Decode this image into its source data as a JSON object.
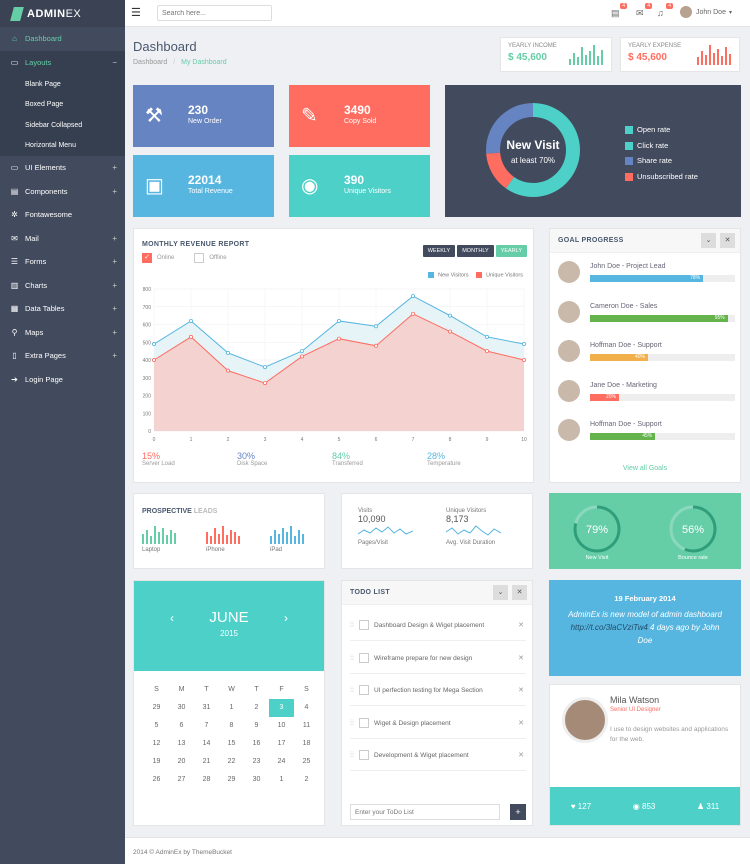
{
  "app": {
    "brand_bold": "ADMIN",
    "brand_thin": "EX"
  },
  "topbar": {
    "search_placeholder": "Search here...",
    "user_name": "John Doe",
    "badges": [
      "4",
      "4",
      "4"
    ]
  },
  "sidebar": {
    "items": [
      {
        "label": "Dashboard",
        "icon": "home-icon",
        "plus": ""
      },
      {
        "label": "Layouts",
        "icon": "layout-icon",
        "plus": "−"
      }
    ],
    "sub": [
      "Blank Page",
      "Boxed Page",
      "Sidebar Collapsed",
      "Horizontal Menu"
    ],
    "items2": [
      {
        "label": "UI Elements",
        "icon": "laptop-icon",
        "plus": "+"
      },
      {
        "label": "Components",
        "icon": "book-icon",
        "plus": "+"
      },
      {
        "label": "Fontawesome",
        "icon": "cogs-icon",
        "plus": ""
      },
      {
        "label": "Mail",
        "icon": "envelope-icon",
        "plus": "+"
      },
      {
        "label": "Forms",
        "icon": "tasks-icon",
        "plus": "+"
      },
      {
        "label": "Charts",
        "icon": "bar-chart-icon",
        "plus": "+"
      },
      {
        "label": "Data Tables",
        "icon": "table-icon",
        "plus": "+"
      },
      {
        "label": "Maps",
        "icon": "map-marker-icon",
        "plus": "+"
      },
      {
        "label": "Extra Pages",
        "icon": "file-icon",
        "plus": "+"
      },
      {
        "label": "Login Page",
        "icon": "sign-in-icon",
        "plus": ""
      }
    ]
  },
  "header": {
    "title": "Dashboard",
    "crumb_root": "Dashboard",
    "crumb_sep": "/",
    "crumb_current": "My Dashboard"
  },
  "yearly_income": {
    "label": "YEARLY INCOME",
    "value": "$ 45,600",
    "color": "#65cea7"
  },
  "yearly_expense": {
    "label": "YEARLY EXPENSE",
    "value": "$ 45,600",
    "color": "#ff6c60"
  },
  "tiles": [
    {
      "num": "230",
      "cap": "New Order",
      "color": "#6683c2",
      "icon": "gavel-icon"
    },
    {
      "num": "3490",
      "cap": "Copy Sold",
      "color": "#ff6c60",
      "icon": "tags-icon"
    },
    {
      "num": "22014",
      "cap": "Total Revenue",
      "color": "#57b6e0",
      "icon": "money-icon"
    },
    {
      "num": "390",
      "cap": "Unique Visitors",
      "color": "#4dd0c8",
      "icon": "eye-icon"
    }
  ],
  "visit": {
    "title": "New Visit",
    "sub": "at least 70%",
    "legend": [
      {
        "label": "Open rate",
        "color": "#4dd0c8"
      },
      {
        "label": "Click rate",
        "color": "#4dd0c8"
      },
      {
        "label": "Share rate",
        "color": "#6683c2"
      },
      {
        "label": "Unsubscribed rate",
        "color": "#ff6c60"
      }
    ]
  },
  "revenue": {
    "title": "MONTHLY REVENUE REPORT",
    "online": "Online",
    "offline": "Offline",
    "btn_weekly": "WEEKLY",
    "btn_monthly": "MONTHLY",
    "btn_yearly": "YEARLY",
    "stats": [
      {
        "val": "15%",
        "lbl": "Server Load",
        "color": "#ff6c60"
      },
      {
        "val": "30%",
        "lbl": "Disk Space",
        "color": "#6683c2"
      },
      {
        "val": "84%",
        "lbl": "Transferred",
        "color": "#65cea7"
      },
      {
        "val": "28%",
        "lbl": "Temperature",
        "color": "#57b6e0"
      }
    ]
  },
  "chart_data": {
    "type": "area",
    "title": "",
    "x": [
      0,
      1,
      2,
      3,
      4,
      5,
      6,
      7,
      8,
      9,
      10
    ],
    "xlim": [
      0,
      10
    ],
    "ylim": [
      0,
      800
    ],
    "yticks": [
      0,
      100,
      200,
      300,
      400,
      500,
      600,
      700,
      800
    ],
    "grid": true,
    "legend_position": "top-right",
    "series": [
      {
        "name": "New Visitors",
        "color": "#57b6e0",
        "values": [
          490,
          620,
          440,
          360,
          450,
          620,
          590,
          760,
          650,
          530,
          490
        ]
      },
      {
        "name": "Unique Visitors",
        "color": "#ff6c60",
        "values": [
          400,
          530,
          340,
          270,
          420,
          520,
          480,
          660,
          560,
          450,
          400
        ]
      }
    ]
  },
  "goals": {
    "title": "GOAL PROGRESS",
    "link": "View all Goals",
    "rows": [
      {
        "name": "John Doe - Project Lead",
        "pct": "78%",
        "frac": 0.78,
        "color": "#57b6e0"
      },
      {
        "name": "Cameron Doe - Sales",
        "pct": "95%",
        "frac": 0.95,
        "color": "#65b34c"
      },
      {
        "name": "Hoffman Doe - Support",
        "pct": "40%",
        "frac": 0.4,
        "color": "#f2b04b"
      },
      {
        "name": "Jane Doe - Marketing",
        "pct": "20%",
        "frac": 0.2,
        "color": "#ff6c60"
      },
      {
        "name": "Hoffman Doe - Support",
        "pct": "45%",
        "frac": 0.45,
        "color": "#65b34c"
      }
    ]
  },
  "leads": {
    "title_a": "PROSPECTIVE",
    "title_b": "LEADS",
    "items": [
      {
        "label": "Laptop",
        "color": "#65cea7"
      },
      {
        "label": "iPhone",
        "color": "#ff6c60"
      },
      {
        "label": "iPad",
        "color": "#57b6e0"
      }
    ]
  },
  "visits": {
    "visits_label": "Visits",
    "visits_val": "10,090",
    "visits_sub": "Pages/Visit",
    "uv_label": "Unique Visitors",
    "uv_val": "8,173",
    "uv_sub": "Avg. Visit Duration"
  },
  "gauges": {
    "items": [
      {
        "val": "79%",
        "lbl": "New Visit",
        "frac": 0.79
      },
      {
        "val": "56%",
        "lbl": "Bounce rate",
        "frac": 0.56
      }
    ]
  },
  "calendar": {
    "month": "JUNE",
    "year": "2015",
    "prev": "‹",
    "next": "›",
    "dow": [
      "S",
      "M",
      "T",
      "W",
      "T",
      "F",
      "S"
    ],
    "weeks": [
      [
        "29",
        "30",
        "31",
        "1",
        "2",
        "3",
        "4"
      ],
      [
        "5",
        "6",
        "7",
        "8",
        "9",
        "10",
        "11"
      ],
      [
        "12",
        "13",
        "14",
        "15",
        "16",
        "17",
        "18"
      ],
      [
        "19",
        "20",
        "21",
        "22",
        "23",
        "24",
        "25"
      ],
      [
        "26",
        "27",
        "28",
        "29",
        "30",
        "1",
        "2"
      ]
    ],
    "today": "3"
  },
  "todo": {
    "title": "TODO LIST",
    "placeholder": "Enter your ToDo List",
    "add": "+",
    "items": [
      "Dashboard Design & Wiget placement",
      "Wireframe prepare for new design",
      "UI perfection testing for Mega Section",
      "Wiget & Design placement",
      "Development & Wiget placement"
    ]
  },
  "tweet": {
    "date": "19 February 2014",
    "text_a": "AdminEx is new model of admin dashboard ",
    "link": "http://t.co/3laCVziTw4",
    "text_b": " 4 days ago by John Doe"
  },
  "profile": {
    "name": "Mila Watson",
    "role": "Senior UI Designer",
    "bio": "I use to design websites and applications for the web.",
    "likes": "127",
    "views": "853",
    "users": "311"
  },
  "footer": {
    "text": "2014 © AdminEx by ThemeBucket"
  }
}
